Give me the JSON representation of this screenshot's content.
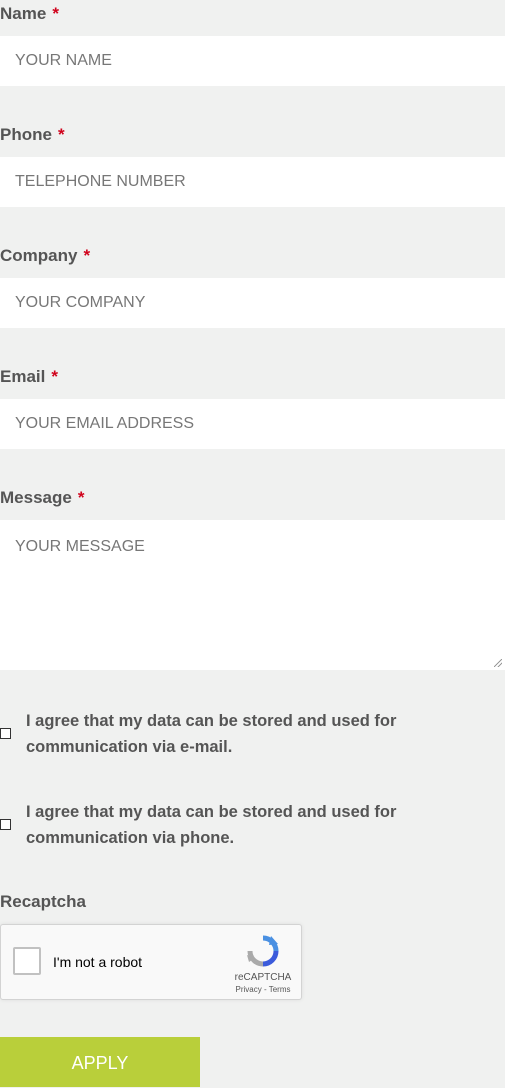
{
  "fields": {
    "name": {
      "label": "Name",
      "required_mark": "*",
      "placeholder": "YOUR NAME"
    },
    "phone": {
      "label": "Phone",
      "required_mark": "*",
      "placeholder": "TELEPHONE NUMBER"
    },
    "company": {
      "label": "Company",
      "required_mark": "*",
      "placeholder": "YOUR COMPANY"
    },
    "email": {
      "label": "Email",
      "required_mark": "*",
      "placeholder": "YOUR EMAIL ADDRESS"
    },
    "message": {
      "label": "Message",
      "required_mark": "*",
      "placeholder": "YOUR MESSAGE"
    }
  },
  "consents": {
    "email": {
      "text": "I agree that my data can be stored and used for communication via e-mail.",
      "checked": false
    },
    "phone": {
      "text": "I agree that my data can be stored and used for communication via phone.",
      "checked": false
    }
  },
  "recaptcha": {
    "label": "Recaptcha",
    "checkbox_text": "I'm not a robot",
    "brand": "reCAPTCHA",
    "links": "Privacy - Terms"
  },
  "submit": {
    "label": "APPLY"
  },
  "colors": {
    "background": "#f0f1f0",
    "accent": "#b9cf3a",
    "required": "#d0021b"
  },
  "icons": {
    "recaptcha_logo": "recaptcha-logo-icon",
    "resize": "resize-grip-icon"
  }
}
